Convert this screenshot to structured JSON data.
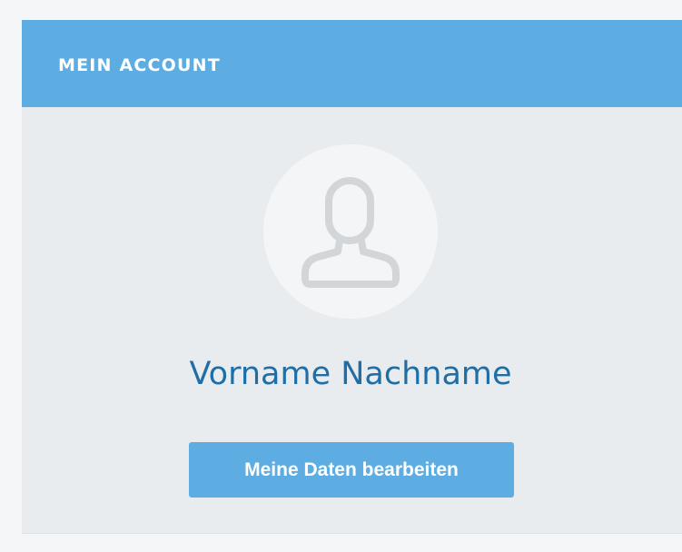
{
  "account_card": {
    "title": "MEIN ACCOUNT",
    "avatar_icon": "user-silhouette-icon",
    "user_name": "Vorname Nachname",
    "edit_button_label": "Meine Daten bearbeiten"
  },
  "colors": {
    "header_background": "#5dade2",
    "card_background": "#e9ecef",
    "name_text": "#1f6fa6",
    "button_background": "#5dade2",
    "avatar_background": "#f4f5f6",
    "avatar_icon": "#d3d6d9"
  }
}
